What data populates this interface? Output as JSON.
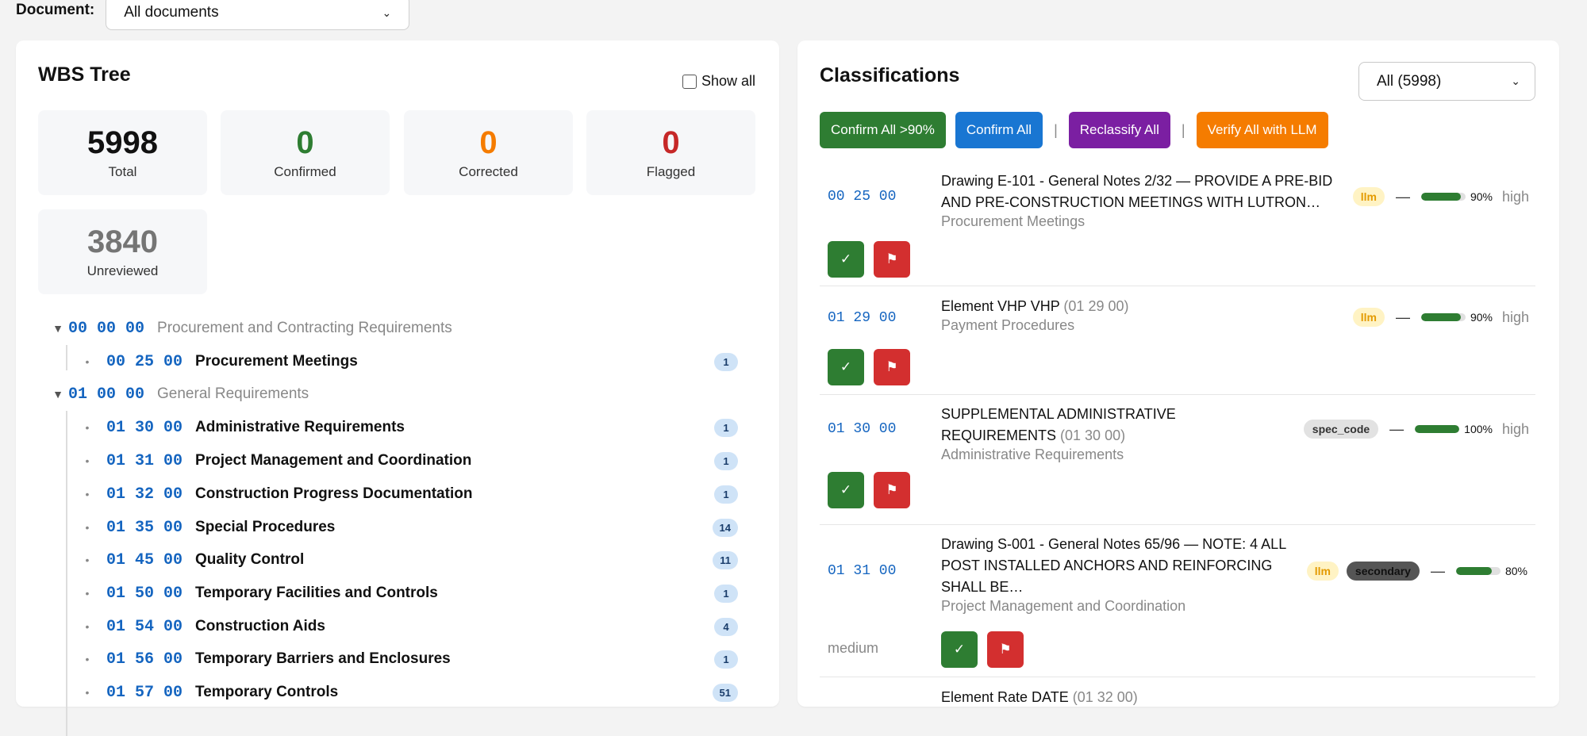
{
  "top": {
    "doc_label": "Document:",
    "doc_select": "All documents"
  },
  "wbs": {
    "title": "WBS Tree",
    "show_all": "Show all",
    "stats": [
      {
        "value": "5998",
        "label": "Total",
        "color": "#111111"
      },
      {
        "value": "0",
        "label": "Confirmed",
        "color": "#2e7d32"
      },
      {
        "value": "0",
        "label": "Corrected",
        "color": "#f57c00"
      },
      {
        "value": "0",
        "label": "Flagged",
        "color": "#c62828"
      },
      {
        "value": "3840",
        "label": "Unreviewed",
        "color": "#757575"
      }
    ],
    "groups": [
      {
        "code": "00 00 00",
        "title": "Procurement and Contracting Requirements",
        "toggle": "▼"
      },
      {
        "code": "01 00 00",
        "title": "General Requirements",
        "toggle": "▼"
      }
    ],
    "items": [
      {
        "code": "00 25 00",
        "title": "Procurement Meetings",
        "count": "1"
      },
      {
        "code": "01 30 00",
        "title": "Administrative Requirements",
        "count": "1"
      },
      {
        "code": "01 31 00",
        "title": "Project Management and Coordination",
        "count": "1"
      },
      {
        "code": "01 32 00",
        "title": "Construction Progress Documentation",
        "count": "1"
      },
      {
        "code": "01 35 00",
        "title": "Special Procedures",
        "count": "14"
      },
      {
        "code": "01 45 00",
        "title": "Quality Control",
        "count": "11"
      },
      {
        "code": "01 50 00",
        "title": "Temporary Facilities and Controls",
        "count": "1"
      },
      {
        "code": "01 54 00",
        "title": "Construction Aids",
        "count": "4"
      },
      {
        "code": "01 56 00",
        "title": "Temporary Barriers and Enclosures",
        "count": "1"
      },
      {
        "code": "01 57 00",
        "title": "Temporary Controls",
        "count": "51"
      }
    ]
  },
  "classifications": {
    "title": "Classifications",
    "filter": "All (5998)",
    "buttons": {
      "confirm_90": "Confirm All >90%",
      "confirm_all": "Confirm All",
      "sep": "|",
      "reclassify": "Reclassify All",
      "verify": "Verify All with LLM"
    },
    "rows": [
      {
        "code": "00 25 00",
        "text": "Drawing E-101 - General Notes 2/32 — PROVIDE A PRE-BID AND PRE-CONSTRUCTION MEETINGS WITH LUTRON…",
        "code_note": "",
        "sub": "Procurement Meetings",
        "source": "llm",
        "source2": "",
        "dash": "—",
        "pct": "90%",
        "pct_value": 90,
        "conf": "high"
      },
      {
        "code": "01 29 00",
        "text": "Element VHP VHP",
        "code_note": "(01 29 00)",
        "sub": "Payment Procedures",
        "source": "llm",
        "source2": "",
        "dash": "—",
        "pct": "90%",
        "pct_value": 90,
        "conf": "high"
      },
      {
        "code": "01 30 00",
        "text": "SUPPLEMENTAL ADMINISTRATIVE REQUIREMENTS",
        "code_note": "(01 30 00)",
        "sub": "Administrative Requirements",
        "source": "spec_code",
        "source2": "",
        "dash": "—",
        "pct": "100%",
        "pct_value": 100,
        "conf": "high"
      },
      {
        "code": "01 31 00",
        "text": "Drawing S-001 - General Notes 65/96 — NOTE: 4 ALL POST INSTALLED ANCHORS AND REINFORCING SHALL BE…",
        "code_note": "",
        "sub": "Project Management and Coordination",
        "source": "llm",
        "source2": "secondary",
        "dash": "—",
        "pct": "80%",
        "pct_value": 80,
        "conf": "medium"
      },
      {
        "text": "Element Rate DATE",
        "code_note": "(01 32 00)"
      }
    ],
    "confirm_icon": "✓",
    "flag_icon": "⚑"
  }
}
